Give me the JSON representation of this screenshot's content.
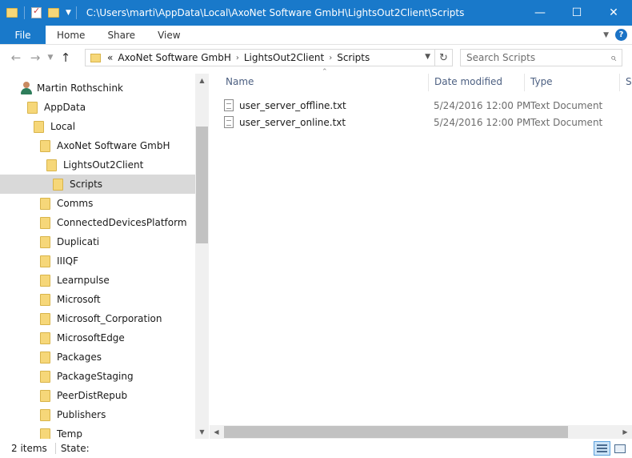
{
  "titlebar": {
    "path": "C:\\Users\\marti\\AppData\\Local\\AxoNet Software GmbH\\LightsOut2Client\\Scripts",
    "minimize": "—",
    "maximize": "☐",
    "close": "✕"
  },
  "ribbon": {
    "tabs": [
      "File",
      "Home",
      "Share",
      "View"
    ],
    "expand_glyph": "⌄",
    "help": "?"
  },
  "address": {
    "overflow": "«",
    "crumbs": [
      "AxoNet Software GmbH",
      "LightsOut2Client",
      "Scripts"
    ],
    "crumb_sep": "›",
    "search_placeholder": "Search Scripts"
  },
  "nav": {
    "user": "Martin Rothschink",
    "items": [
      {
        "label": "AppData",
        "indent": 1
      },
      {
        "label": "Local",
        "indent": 2
      },
      {
        "label": "AxoNet Software GmbH",
        "indent": 3
      },
      {
        "label": "LightsOut2Client",
        "indent": 4
      },
      {
        "label": "Scripts",
        "indent": 5,
        "selected": true
      },
      {
        "label": "Comms",
        "indent": 3
      },
      {
        "label": "ConnectedDevicesPlatform",
        "indent": 3
      },
      {
        "label": "Duplicati",
        "indent": 3
      },
      {
        "label": "IIIQF",
        "indent": 3
      },
      {
        "label": "Learnpulse",
        "indent": 3
      },
      {
        "label": "Microsoft",
        "indent": 3
      },
      {
        "label": "Microsoft_Corporation",
        "indent": 3
      },
      {
        "label": "MicrosoftEdge",
        "indent": 3
      },
      {
        "label": "Packages",
        "indent": 3
      },
      {
        "label": "PackageStaging",
        "indent": 3
      },
      {
        "label": "PeerDistRepub",
        "indent": 3
      },
      {
        "label": "Publishers",
        "indent": 3
      },
      {
        "label": "Temp",
        "indent": 3
      }
    ]
  },
  "content": {
    "columns": {
      "name": "Name",
      "date": "Date modified",
      "type": "Type",
      "size": "S"
    },
    "files": [
      {
        "name": "user_server_offline.txt",
        "date": "5/24/2016 12:00 PM",
        "type": "Text Document"
      },
      {
        "name": "user_server_online.txt",
        "date": "5/24/2016 12:00 PM",
        "type": "Text Document"
      }
    ]
  },
  "status": {
    "items": "2 items",
    "state": "State:"
  }
}
